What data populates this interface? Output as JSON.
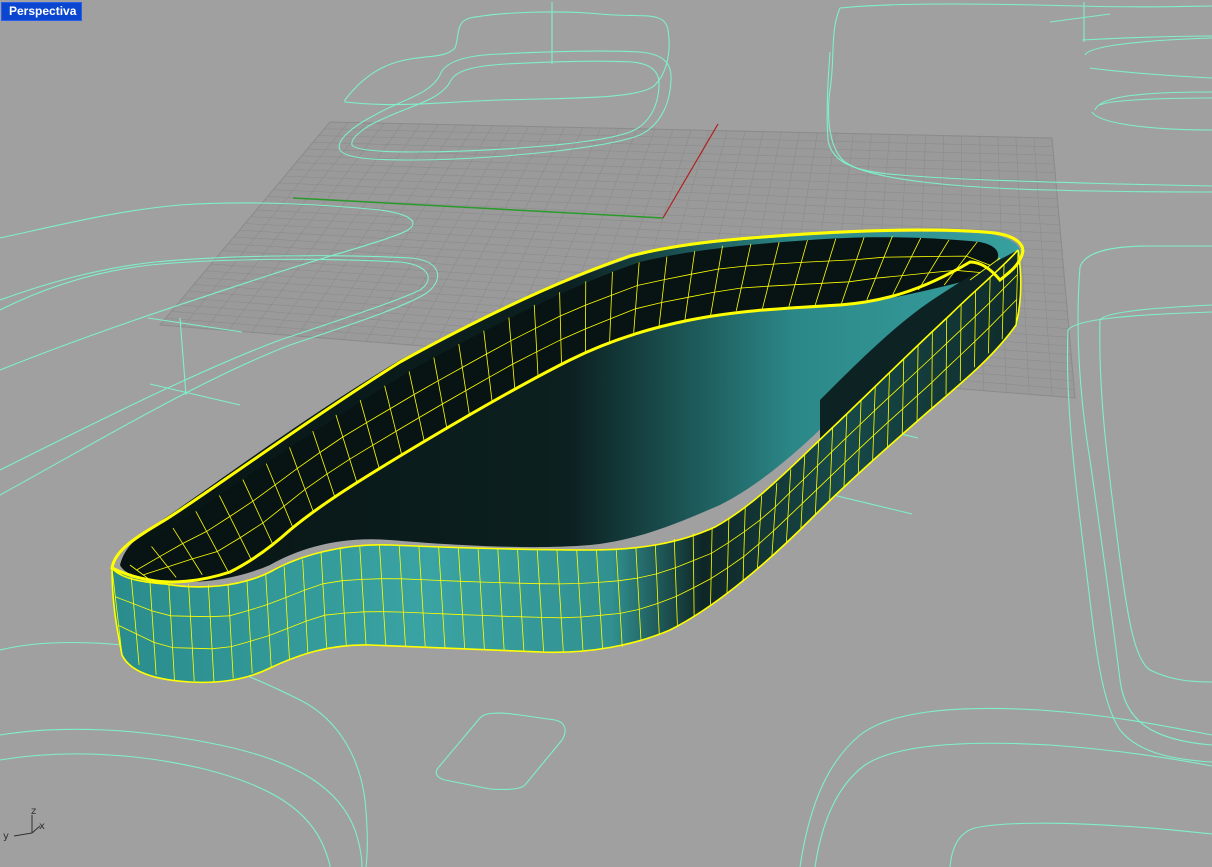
{
  "viewport": {
    "label": "Perspectiva",
    "background": "#a0a0a0",
    "label_background": "#0a46d0"
  },
  "axis_gizmo": {
    "x": "x",
    "y": "y",
    "z": "z"
  },
  "colors": {
    "curves": "#7ff0c8",
    "selection": "#ffff00",
    "surface_light": "#3a9a9a",
    "surface_dark": "#0c1818",
    "grid": "#8a8a8a",
    "x_axis": "#b02020",
    "y_axis": "#2a9a2a"
  }
}
